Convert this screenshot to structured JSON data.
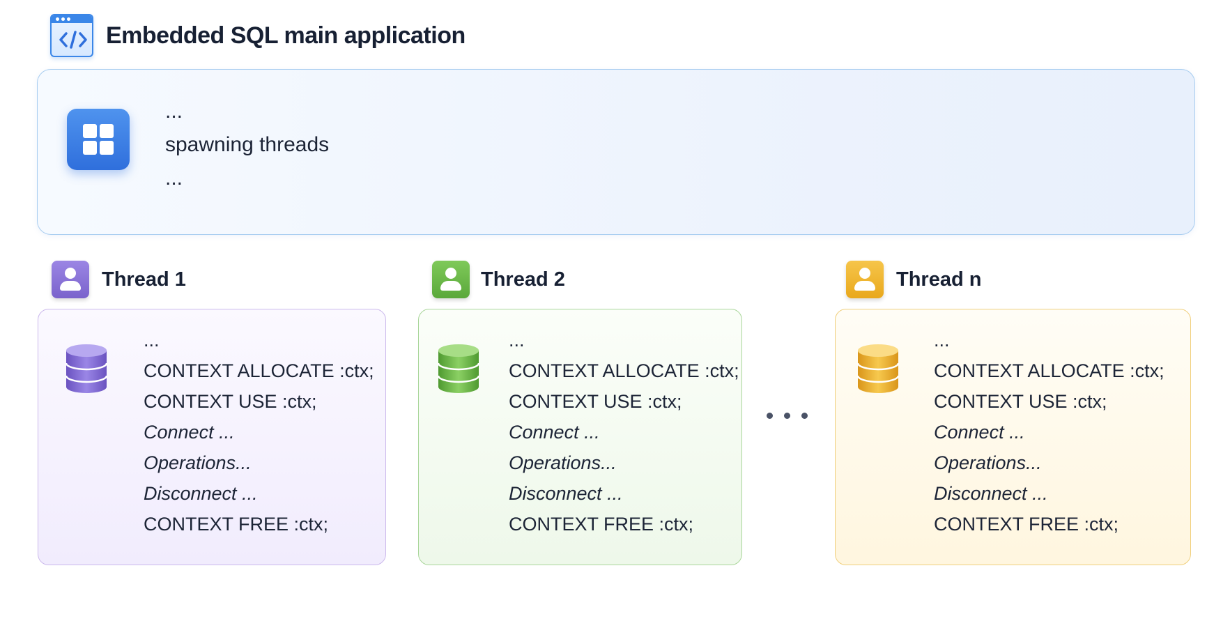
{
  "header": {
    "title": "Embedded SQL main application",
    "icon": "code-window-icon"
  },
  "main_app": {
    "icon": "grid-apps-icon",
    "lines": [
      "...",
      "spawning threads",
      "..."
    ]
  },
  "threads": [
    {
      "title": "Thread 1",
      "color": "#8a72d8",
      "user_icon": "user-icon",
      "db_icon": "database-icon",
      "lines": [
        "...",
        "CONTEXT ALLOCATE :ctx;",
        "CONTEXT USE :ctx;",
        "Connect ...",
        "Operations...",
        "Disconnect ...",
        "CONTEXT FREE :ctx;"
      ]
    },
    {
      "title": "Thread 2",
      "color": "#6cb84a",
      "user_icon": "user-icon",
      "db_icon": "database-icon",
      "lines": [
        "...",
        "CONTEXT ALLOCATE :ctx;",
        "CONTEXT USE :ctx;",
        "Connect ...",
        "Operations...",
        "Disconnect ...",
        "CONTEXT FREE :ctx;"
      ]
    },
    {
      "title": "Thread n",
      "color": "#efb52e",
      "user_icon": "user-icon",
      "db_icon": "database-icon",
      "lines": [
        "...",
        "CONTEXT ALLOCATE :ctx;",
        "CONTEXT USE :ctx;",
        "Connect ...",
        "Operations...",
        "Disconnect ...",
        "CONTEXT FREE :ctx;"
      ]
    }
  ],
  "colors": {
    "accent_blue": "#3a86e8",
    "main_border": "#a8cdf0"
  }
}
